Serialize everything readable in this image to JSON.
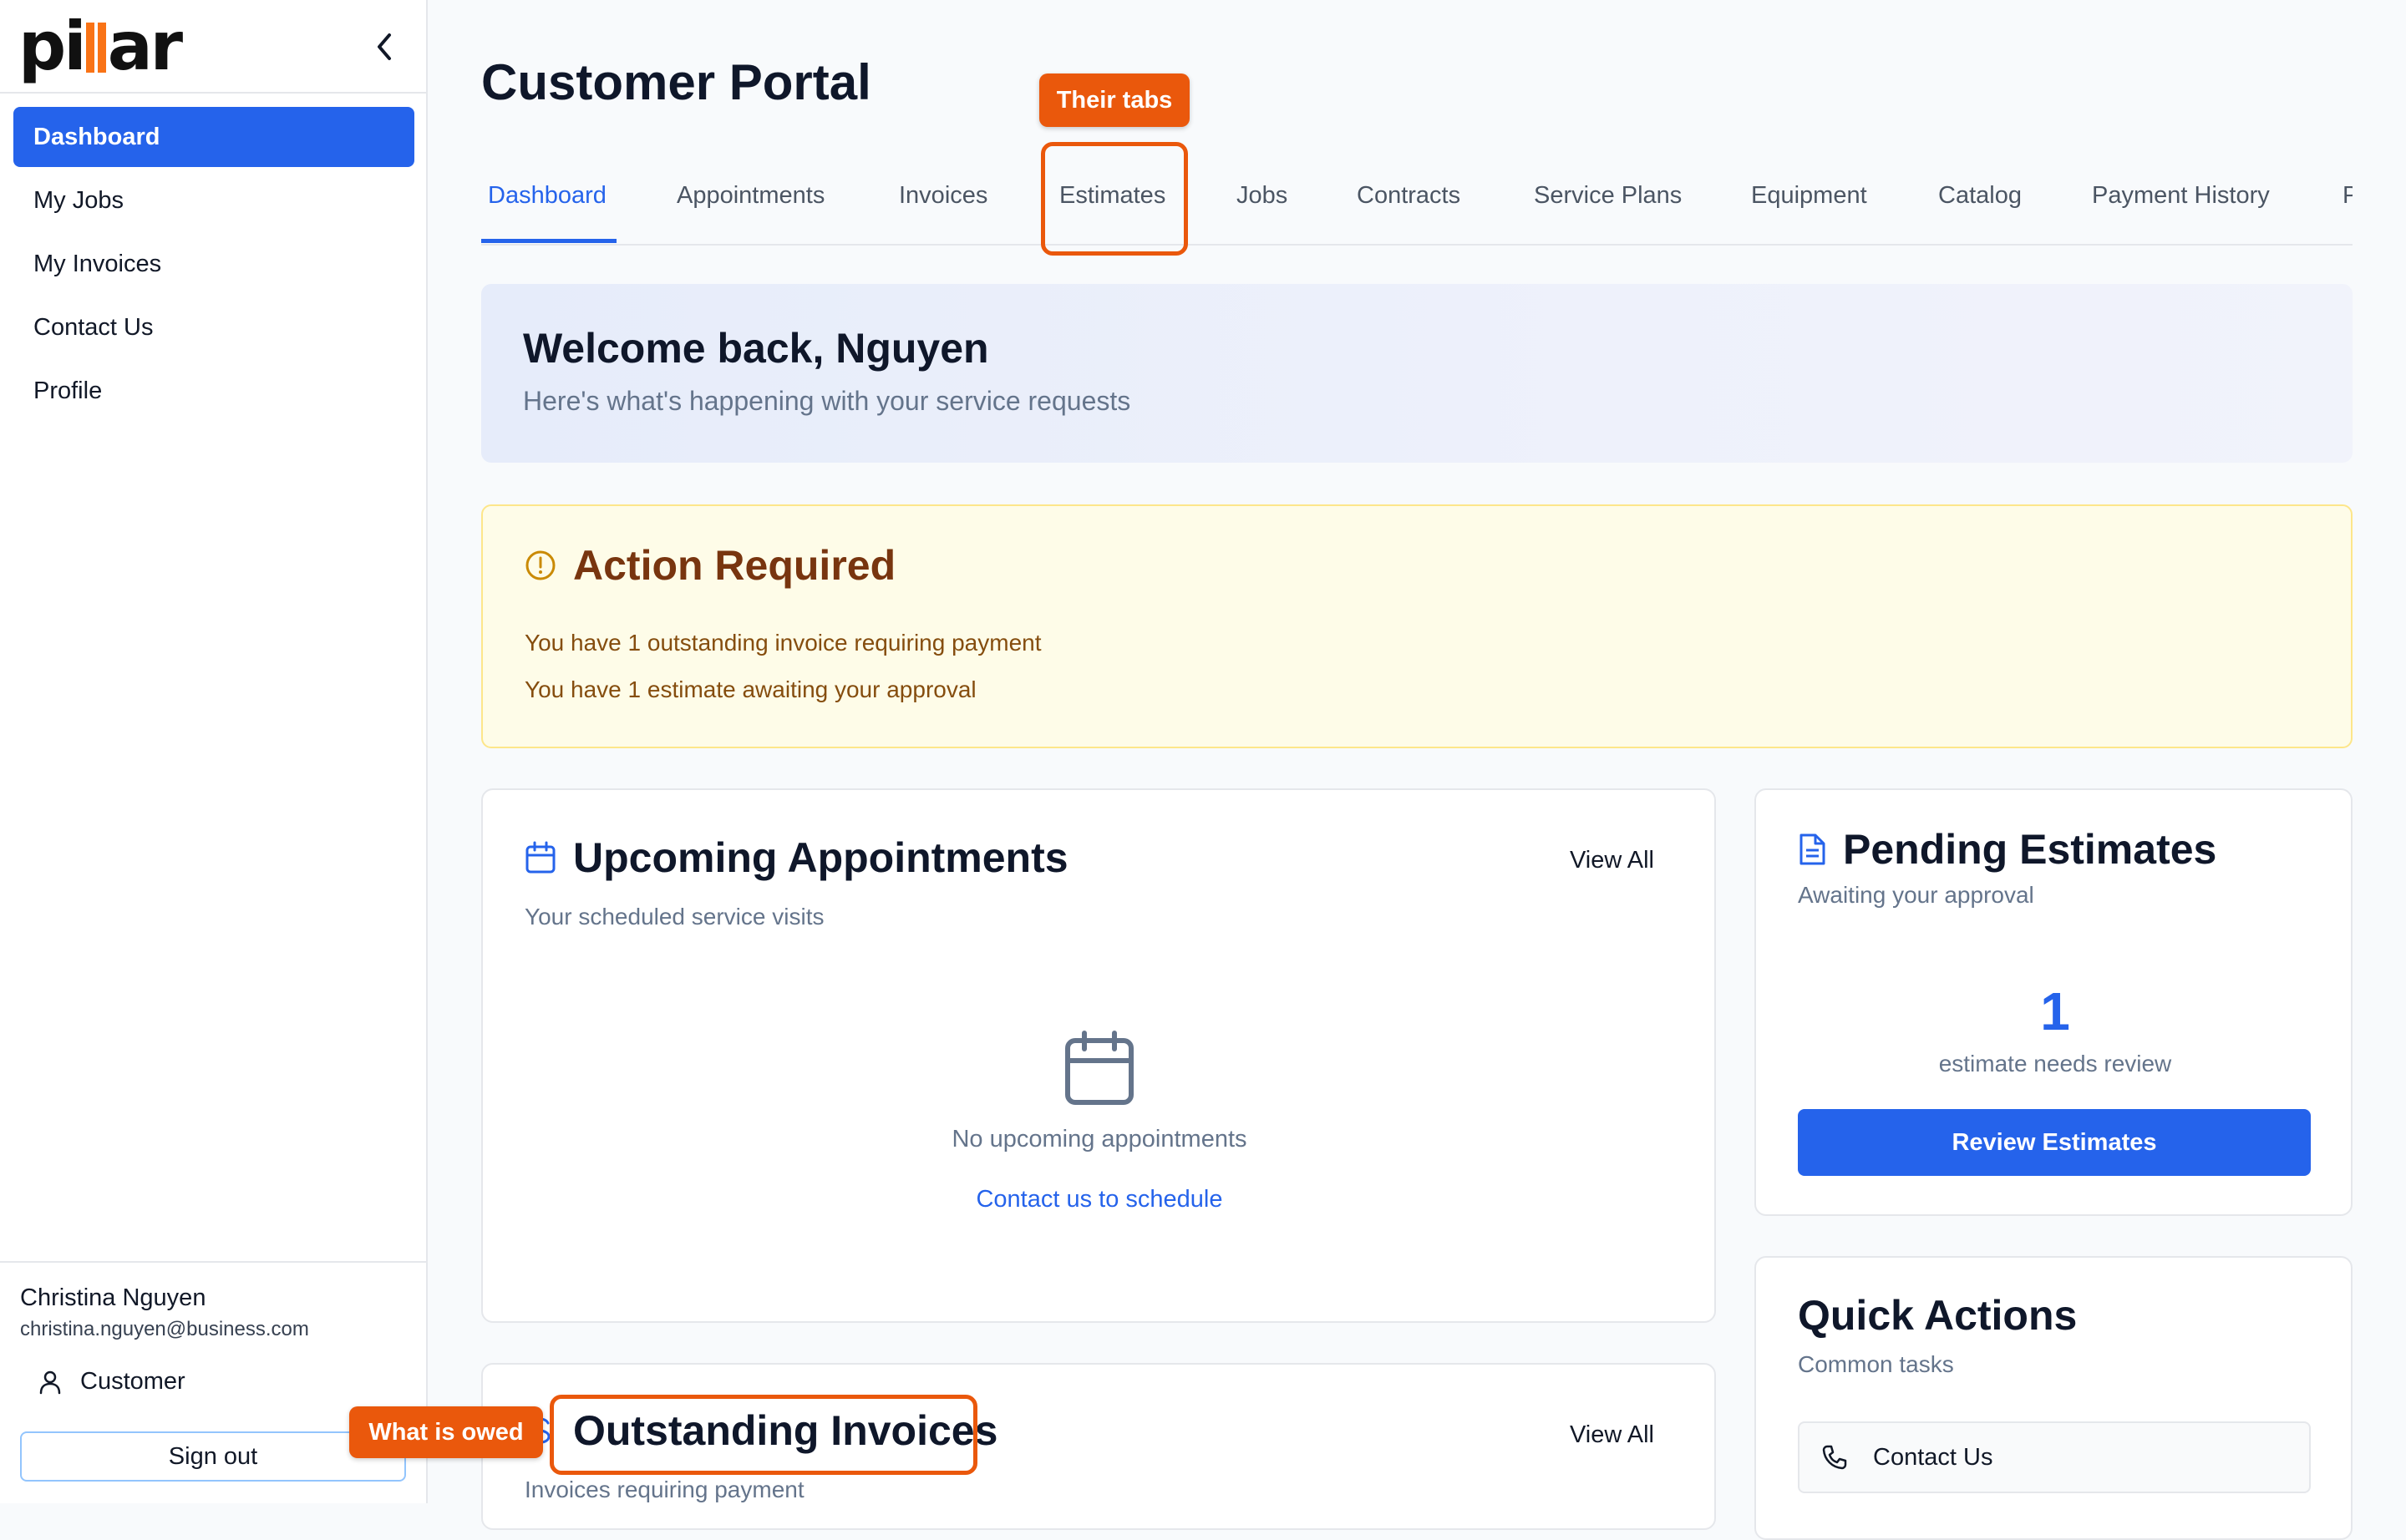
{
  "app": {
    "logo_text": "pillar"
  },
  "sidebar": {
    "items": [
      {
        "label": "Dashboard",
        "active": true
      },
      {
        "label": "My Jobs",
        "active": false
      },
      {
        "label": "My Invoices",
        "active": false
      },
      {
        "label": "Contact Us",
        "active": false
      },
      {
        "label": "Profile",
        "active": false
      }
    ],
    "user": {
      "name": "Christina Nguyen",
      "email": "christina.nguyen@business.com",
      "role": "Customer"
    },
    "sign_out": "Sign out"
  },
  "header": {
    "title": "Customer Portal"
  },
  "tabs": [
    "Dashboard",
    "Appointments",
    "Invoices",
    "Estimates",
    "Jobs",
    "Contracts",
    "Service Plans",
    "Equipment",
    "Catalog",
    "Payment History",
    "P"
  ],
  "welcome": {
    "title": "Welcome back, Nguyen",
    "subtitle": "Here's what's happening with your service requests"
  },
  "action_required": {
    "title": "Action Required",
    "lines": [
      "You have 1 outstanding invoice requiring payment",
      "You have 1 estimate awaiting your approval"
    ]
  },
  "appointments": {
    "title": "Upcoming Appointments",
    "subtitle": "Your scheduled service visits",
    "view_all": "View All",
    "empty_text": "No upcoming appointments",
    "link": "Contact us to schedule"
  },
  "invoices": {
    "title": "Outstanding Invoices",
    "subtitle": "Invoices requiring payment",
    "view_all": "View All"
  },
  "estimates": {
    "title": "Pending Estimates",
    "subtitle": "Awaiting your approval",
    "count": "1",
    "count_label": "estimate needs review",
    "button": "Review Estimates"
  },
  "quick_actions": {
    "title": "Quick Actions",
    "subtitle": "Common tasks",
    "items": [
      "Contact Us"
    ]
  },
  "annotations": {
    "tabs_callout": "Their tabs",
    "owed_callout": "What is owed"
  },
  "colors": {
    "accent": "#2563eb",
    "annotation": "#ea580c",
    "warning_bg": "#fefce8",
    "warning_text": "#78350f"
  }
}
